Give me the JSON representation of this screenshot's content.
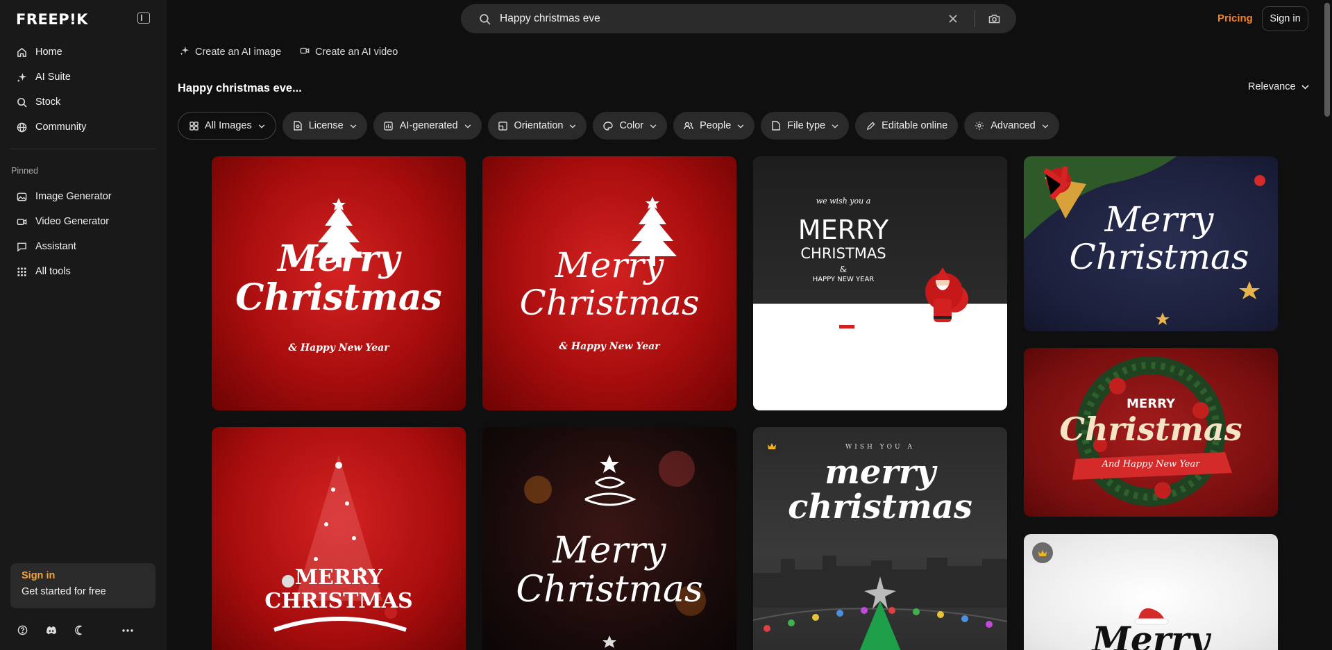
{
  "brand": {
    "logo_text": "FREEP!K"
  },
  "sidebar": {
    "items": [
      {
        "label": "Home",
        "icon": "home-icon"
      },
      {
        "label": "AI Suite",
        "icon": "sparkle-icon"
      },
      {
        "label": "Stock",
        "icon": "search-icon"
      },
      {
        "label": "Community",
        "icon": "globe-icon"
      }
    ],
    "pinned_label": "Pinned",
    "pinned": [
      {
        "label": "Image Generator",
        "icon": "image-icon"
      },
      {
        "label": "Video Generator",
        "icon": "video-icon"
      },
      {
        "label": "Assistant",
        "icon": "chat-icon"
      },
      {
        "label": "All tools",
        "icon": "grid-icon"
      }
    ],
    "signin_card": {
      "title": "Sign in",
      "subtitle": "Get started for free"
    }
  },
  "header": {
    "search_value": "Happy christmas eve",
    "pricing_label": "Pricing",
    "signin_label": "Sign in"
  },
  "ai_links": [
    {
      "label": "Create an AI image"
    },
    {
      "label": "Create an AI video"
    }
  ],
  "results": {
    "title": "Happy christmas eve...",
    "sort_label": "Relevance"
  },
  "filters": [
    {
      "label": "All Images",
      "icon": "grid-icon"
    },
    {
      "label": "License",
      "icon": "file-icon"
    },
    {
      "label": "AI-generated",
      "icon": "ai-icon"
    },
    {
      "label": "Orientation",
      "icon": "orientation-icon"
    },
    {
      "label": "Color",
      "icon": "palette-icon"
    },
    {
      "label": "People",
      "icon": "people-icon"
    },
    {
      "label": "File type",
      "icon": "file-icon"
    },
    {
      "label": "Editable online",
      "icon": "pen-icon"
    },
    {
      "label": "Advanced",
      "icon": "gear-icon"
    }
  ],
  "cards": {
    "c1": {
      "line1": "Merry",
      "line2": "Christmas",
      "line3": "& Happy New Year"
    },
    "c2": {
      "line1": "Merry",
      "line2": "Christmas",
      "line3": "& Happy New Year"
    },
    "c3": {
      "line0": "we wish you a",
      "line1": "MERRY",
      "line2": "CHRISTMAS",
      "line3": "&",
      "line4": "HAPPY NEW YEAR"
    },
    "c4": {
      "line1": "Merry",
      "line2": "Christmas"
    },
    "c5": {
      "line1": "MERRY",
      "line2": "Christmas",
      "line3": "And Happy New Year"
    },
    "c6": {
      "line1": "MERRY",
      "line2": "CHRISTMAS"
    },
    "c7": {
      "line1": "Merry",
      "line2": "Christmas"
    },
    "c8": {
      "line0": "WISH YOU A",
      "line1": "merry",
      "line2": "christmas"
    },
    "c9": {
      "line1": "Merry"
    }
  },
  "colors": {
    "accent": "#f58220",
    "card_signin": "#f5a33b"
  }
}
